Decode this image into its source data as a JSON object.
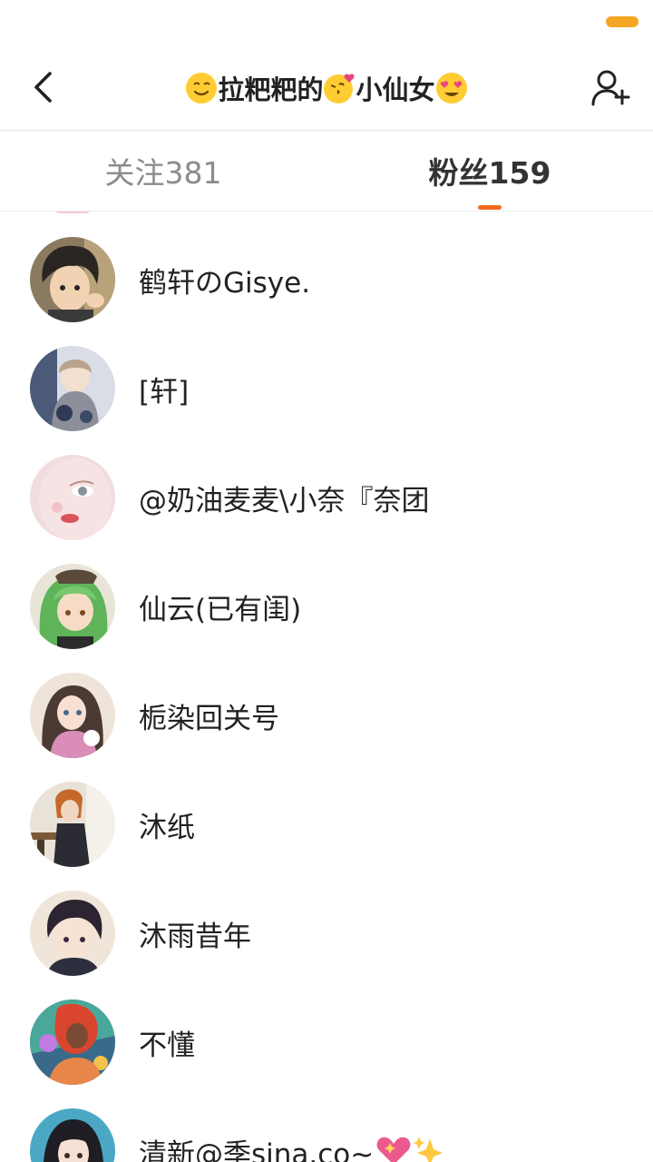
{
  "header": {
    "title_parts": [
      "拉粑粑的",
      "小仙女"
    ],
    "icons": {
      "back": "back-chevron-icon",
      "add_friend": "add-user-icon",
      "title_emoji_1": "smiling-face-emoji",
      "title_emoji_2": "kissing-face-emoji",
      "title_emoji_3": "heart-eyes-emoji"
    }
  },
  "tabs": {
    "following": "关注381",
    "followers": "粉丝159",
    "active": "followers"
  },
  "followers": [
    {
      "name": "鹤轩のGisye.",
      "avatar_icon": "anime-boy-avatar"
    },
    {
      "name": "[轩]",
      "avatar_icon": "anime-girl-hoodie-avatar"
    },
    {
      "name": "@奶油麦麦\\小奈『奈团",
      "avatar_icon": "painted-face-avatar"
    },
    {
      "name": "仙云(已有闺)",
      "avatar_icon": "green-hair-girl-avatar"
    },
    {
      "name": "栀染回关号",
      "avatar_icon": "anime-girl-cat-avatar"
    },
    {
      "name": "沐纸",
      "avatar_icon": "cafe-girl-avatar"
    },
    {
      "name": "沐雨昔年",
      "avatar_icon": "dark-hair-boy-avatar"
    },
    {
      "name": "不懂",
      "avatar_icon": "colorful-art-avatar"
    },
    {
      "name": "清新@季sina.co~",
      "avatar_icon": "black-hair-girl-avatar",
      "trailing_icons": [
        "sparkling-heart-emoji",
        "sparkles-emoji"
      ]
    }
  ],
  "colors": {
    "accent": "#f06a1d",
    "battery": "#f5a623",
    "text_primary": "#222222",
    "text_inactive": "#8c8c8c"
  }
}
